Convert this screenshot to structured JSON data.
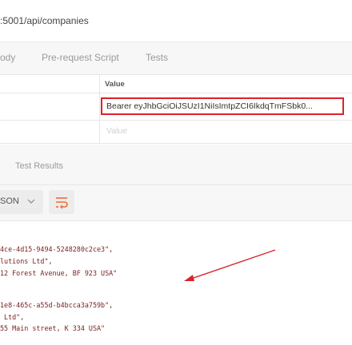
{
  "url": {
    "text": ":5001/api/companies"
  },
  "request_tabs": [
    {
      "label": "ody"
    },
    {
      "label": "Pre-request Script"
    },
    {
      "label": "Tests"
    }
  ],
  "headers": {
    "value_column": "Value",
    "authorization_value": "Bearer eyJhbGciOiJSUzI1NiIsImtpZCI6IkdqTmFSbk0...",
    "value_placeholder": "Value"
  },
  "response_tabs": [
    {
      "label": "Test Results"
    }
  ],
  "response_toolbar": {
    "format": "SON",
    "icons": [
      "chevron-down-icon",
      "wrap-lines-icon"
    ],
    "accent_color": "#f26b3a"
  },
  "response_body": {
    "lines": [
      "4ce-4d15-9494-5248280c2ce3\",",
      "lutions Ltd\",",
      "12 Forest Avenue, BF 923 USA\"",
      "",
      "1e8-465c-a55d-b4bcca3a759b\",",
      " Ltd\",",
      "55 Main street, K 334 USA\""
    ]
  },
  "annotation": {
    "arrow_color": "#d9232a"
  }
}
